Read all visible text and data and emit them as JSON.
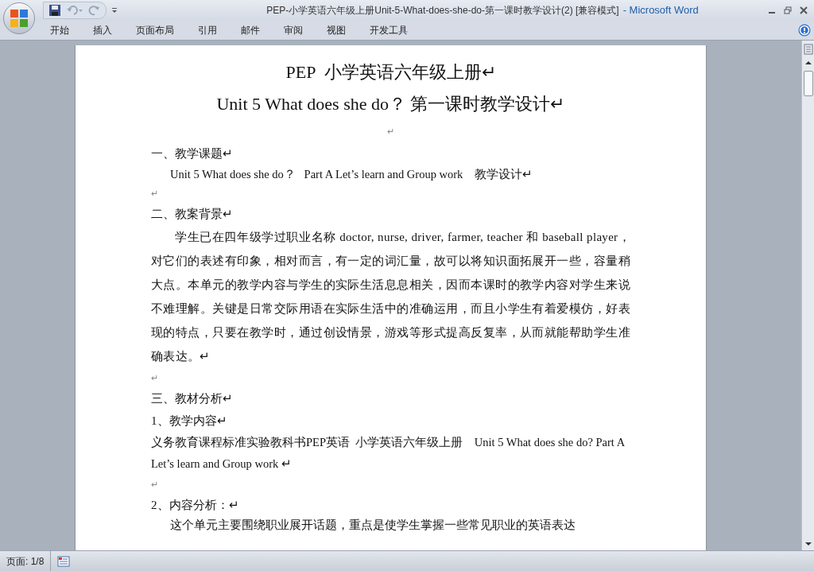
{
  "window": {
    "title": "PEP-小学英语六年级上册Unit-5-What-does-she-do-第一课时教学设计(2) [兼容模式]",
    "app_name": "- Microsoft Word"
  },
  "ribbon_tabs": [
    {
      "label": "开始",
      "selected": false
    },
    {
      "label": "插入",
      "selected": false
    },
    {
      "label": "页面布局",
      "selected": false
    },
    {
      "label": "引用",
      "selected": false
    },
    {
      "label": "邮件",
      "selected": false
    },
    {
      "label": "审阅",
      "selected": false
    },
    {
      "label": "视图",
      "selected": false
    },
    {
      "label": "开发工具",
      "selected": false
    }
  ],
  "document": {
    "paragraphs": [
      {
        "kind": "title",
        "text": "PEP  小学英语六年级上册↵"
      },
      {
        "kind": "title",
        "text": "Unit 5 What does she do？ 第一课时教学设计↵"
      },
      {
        "kind": "center_empty",
        "text": "↵"
      },
      {
        "kind": "heading",
        "text": "一、教学课题↵"
      },
      {
        "kind": "indent",
        "text": "Unit 5 What does she do？   Part A Let’s learn and Group work    教学设计↵"
      },
      {
        "kind": "empty",
        "text": "↵"
      },
      {
        "kind": "heading",
        "text": "二、教案背景↵"
      },
      {
        "kind": "body",
        "text": "学生已在四年级学过职业名称 doctor, nurse, driver, farmer, teacher 和 baseball player，对它们的表述有印象，相对而言，有一定的词汇量，故可以将知识面拓展开一些，容量稍大点。本单元的教学内容与学生的实际生活息息相关，因而本课时的教学内容对学生来说不难理解。关键是日常交际用语在实际生活中的准确运用，而且小学生有着爱模仿，好表现的特点，只要在教学时，通过创设情景，游戏等形式提高反复率，从而就能帮助学生准确表达。↵"
      },
      {
        "kind": "empty",
        "text": "↵"
      },
      {
        "kind": "heading",
        "text": "三、教材分析↵"
      },
      {
        "kind": "heading",
        "text": "1、教学内容↵"
      },
      {
        "kind": "plain",
        "text": "义务教育课程标准实验教科书PEP英语  小学英语六年级上册    Unit 5 What does she do? Part A Let’s learn and Group work ↵"
      },
      {
        "kind": "empty",
        "text": "↵"
      },
      {
        "kind": "heading",
        "text": "2、内容分析：↵"
      },
      {
        "kind": "cut",
        "text": "这个单元主要围绕职业展开话题，重点是使学生掌握一些常见职业的英语表达"
      }
    ]
  },
  "status_bar": {
    "page": "页面: 1/8"
  }
}
